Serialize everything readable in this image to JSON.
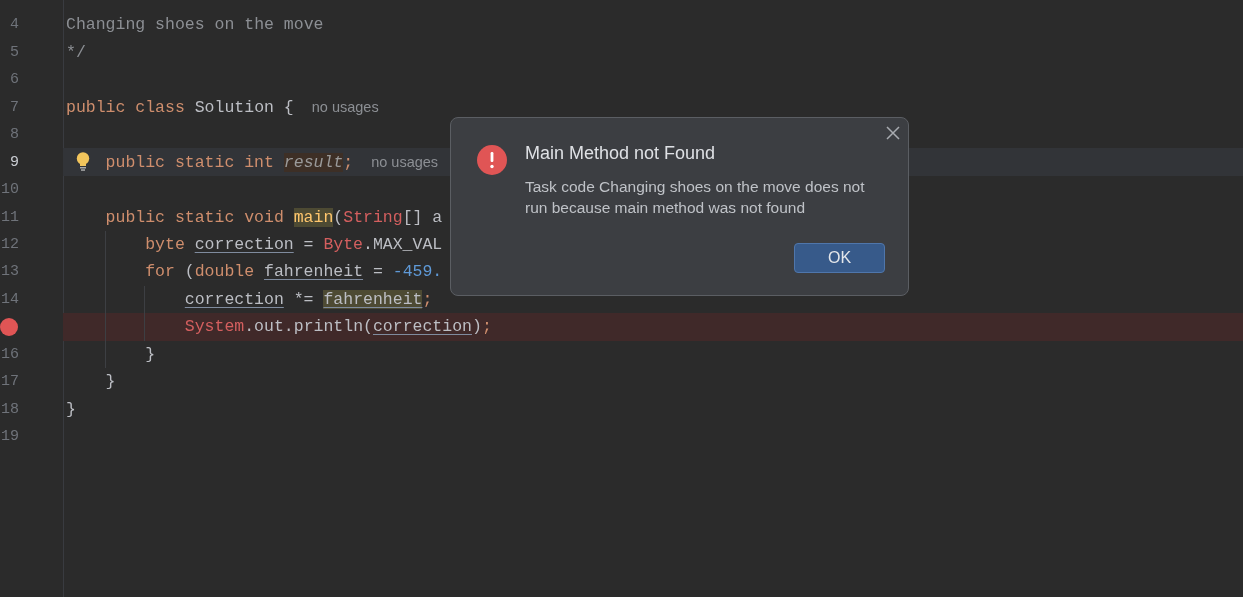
{
  "editor": {
    "lines": [
      {
        "number": "4",
        "current": false,
        "breakpoint": false,
        "bulb": false,
        "tokens": [
          {
            "kind": "comment",
            "t": "Changing shoes on the move"
          }
        ]
      },
      {
        "number": "5",
        "current": false,
        "breakpoint": false,
        "bulb": false,
        "tokens": [
          {
            "kind": "comment",
            "t": "*/"
          }
        ]
      },
      {
        "number": "6",
        "current": false,
        "breakpoint": false,
        "bulb": false
      },
      {
        "number": "7",
        "current": false,
        "breakpoint": false,
        "bulb": false,
        "tokens": [
          {
            "kind": "kw",
            "t": "public"
          },
          {
            "kind": "kw",
            "t": "class",
            "gap": true
          },
          {
            "kind": "plain",
            "t": "Solution",
            "gap": true
          },
          {
            "kind": "plain",
            "t": "{",
            "gap": true
          },
          {
            "kind": "hint",
            "t": "no usages"
          }
        ],
        "children": [
          {
            "number": "8",
            "current": false,
            "breakpoint": false,
            "bulb": false
          },
          {
            "number": "9",
            "current": true,
            "breakpoint": false,
            "bulb": true,
            "tokens": [
              {
                "kind": "kw",
                "t": "public"
              },
              {
                "kind": "kw",
                "t": "static",
                "gap": true
              },
              {
                "kind": "kw",
                "t": "int",
                "gap": true
              },
              {
                "kind": "warn",
                "t": "result",
                "gap": true
              },
              {
                "kind": "kw",
                "t": ";"
              },
              {
                "kind": "hint",
                "t": "no usages"
              }
            ]
          },
          {
            "number": "10",
            "current": false,
            "breakpoint": false,
            "bulb": false
          },
          {
            "number": "11",
            "current": false,
            "breakpoint": false,
            "bulb": false,
            "tokens": [
              {
                "kind": "kw",
                "t": "public"
              },
              {
                "kind": "kw",
                "t": "static",
                "gap": true
              },
              {
                "kind": "kw",
                "t": "void",
                "gap": true
              },
              {
                "kind": "fn",
                "t": "main",
                "gap": true
              },
              {
                "kind": "plain",
                "t": "("
              },
              {
                "kind": "type",
                "t": "String"
              },
              {
                "kind": "plain",
                "t": "[]"
              },
              {
                "kind": "plain",
                "t": "a",
                "gap": true
              }
            ],
            "children": [
              {
                "number": "12",
                "current": false,
                "breakpoint": false,
                "bulb": false,
                "tokens": [
                  {
                    "kind": "kw",
                    "t": "byte"
                  },
                  {
                    "kind": "var",
                    "t": "correction",
                    "gap": true
                  },
                  {
                    "kind": "plain",
                    "t": "=",
                    "gap": true
                  },
                  {
                    "kind": "type",
                    "t": "Byte",
                    "gap": true
                  },
                  {
                    "kind": "plain",
                    "t": ".MAX_VAL"
                  }
                ]
              },
              {
                "number": "13",
                "current": false,
                "breakpoint": false,
                "bulb": false,
                "tokens": [
                  {
                    "kind": "kw",
                    "t": "for"
                  },
                  {
                    "kind": "plain",
                    "t": "(",
                    "gap": true
                  },
                  {
                    "kind": "kw",
                    "t": "double"
                  },
                  {
                    "kind": "var",
                    "t": "fahrenheit",
                    "gap": true
                  },
                  {
                    "kind": "plain",
                    "t": "=",
                    "gap": true
                  },
                  {
                    "kind": "num",
                    "t": "-459.",
                    "gap": true
                  }
                ],
                "children": [
                  {
                    "number": "14",
                    "current": false,
                    "breakpoint": false,
                    "bulb": false,
                    "tokens": [
                      {
                        "kind": "var",
                        "t": "correction"
                      },
                      {
                        "kind": "plain",
                        "t": "*=",
                        "gap": true
                      },
                      {
                        "kind": "varhl",
                        "t": "fahrenheit",
                        "gap": true
                      },
                      {
                        "kind": "kw",
                        "t": ";"
                      }
                    ]
                  },
                  {
                    "current": false,
                    "breakpoint": true,
                    "bulb": false,
                    "tokens": [
                      {
                        "kind": "type",
                        "t": "System"
                      },
                      {
                        "kind": "plain",
                        "t": ".out.println("
                      },
                      {
                        "kind": "var",
                        "t": "correction"
                      },
                      {
                        "kind": "plain",
                        "t": ")"
                      },
                      {
                        "kind": "kw",
                        "t": ";"
                      }
                    ]
                  }
                ]
              },
              {
                "number": "16",
                "current": false,
                "breakpoint": false,
                "bulb": false,
                "tokens": [
                  {
                    "kind": "plain",
                    "t": "}"
                  }
                ]
              }
            ]
          },
          {
            "number": "17",
            "current": false,
            "breakpoint": false,
            "bulb": false,
            "tokens": [
              {
                "kind": "plain",
                "t": "}"
              }
            ]
          }
        ]
      },
      {
        "number": "18",
        "current": false,
        "breakpoint": false,
        "bulb": false,
        "tokens": [
          {
            "kind": "plain",
            "t": "}"
          }
        ]
      },
      {
        "number": "19",
        "current": false,
        "breakpoint": false,
        "bulb": false
      }
    ]
  },
  "dialog": {
    "title": "Main Method not Found",
    "message": "Task code Changing shoes on the move does not run because main method was not found",
    "buttons": [
      "OK"
    ]
  }
}
